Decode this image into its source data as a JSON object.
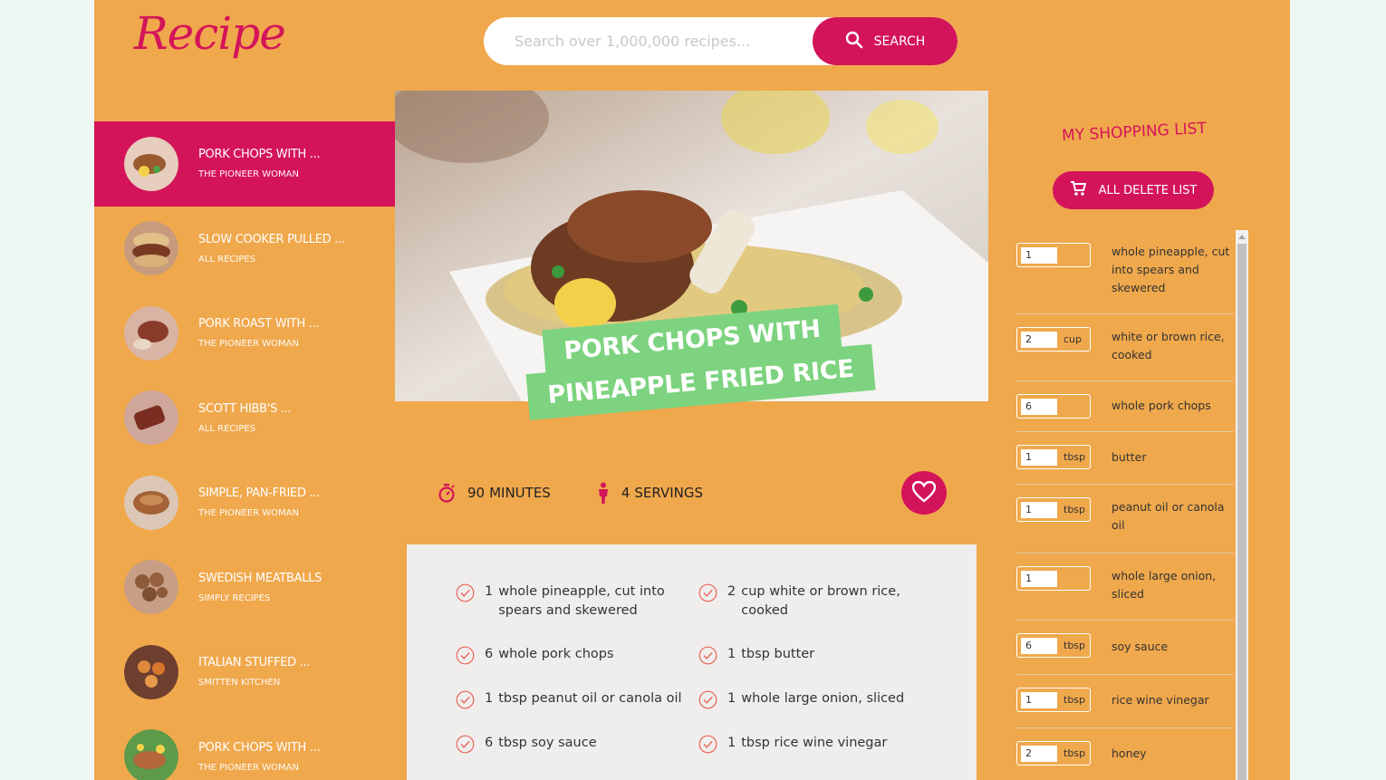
{
  "app": {
    "logo_text": "Recipe"
  },
  "search": {
    "placeholder": "Search over 1,000,000 recipes...",
    "button_label": "SEARCH",
    "icon": "search-icon"
  },
  "results": [
    {
      "title": "Pork Chops with ...",
      "publisher": "The Pioneer Woman",
      "active": true
    },
    {
      "title": "Slow Cooker Pulled ...",
      "publisher": "All Recipes",
      "active": false
    },
    {
      "title": "Pork Roast with ...",
      "publisher": "The Pioneer Woman",
      "active": false
    },
    {
      "title": "Scott Hibb's ...",
      "publisher": "All Recipes",
      "active": false
    },
    {
      "title": "Simple, Pan-Fried ...",
      "publisher": "The Pioneer Woman",
      "active": false
    },
    {
      "title": "Swedish Meatballs",
      "publisher": "Simply Recipes",
      "active": false
    },
    {
      "title": "Italian Stuffed ...",
      "publisher": "Smitten Kitchen",
      "active": false
    },
    {
      "title": "Pork Chops with ...",
      "publisher": "The Pioneer Woman",
      "active": false
    }
  ],
  "recipe": {
    "title_line1": "PORK CHOPS WITH",
    "title_line2": "PINEAPPLE FRIED RICE",
    "minutes_value": "90",
    "minutes_label": "MINUTES",
    "servings_value": "4",
    "servings_label": "SERVINGS",
    "ingredients": [
      {
        "count": "1",
        "text": "whole pineapple, cut into spears and skewered"
      },
      {
        "count": "2",
        "text": "cup white or brown rice, cooked"
      },
      {
        "count": "6",
        "text": "whole pork chops"
      },
      {
        "count": "1",
        "text": "tbsp butter"
      },
      {
        "count": "1",
        "text": "tbsp peanut oil or canola oil"
      },
      {
        "count": "1",
        "text": "whole large onion, sliced"
      },
      {
        "count": "6",
        "text": "tbsp soy sauce"
      },
      {
        "count": "1",
        "text": "tbsp rice wine vinegar"
      }
    ]
  },
  "shopping": {
    "title": "MY SHOPPING LIST",
    "delete_label": "ALL DELETE LIST",
    "items": [
      {
        "qty": "1",
        "unit": "",
        "desc": "whole pineapple, cut into spears and skewered"
      },
      {
        "qty": "2",
        "unit": "cup",
        "desc": "white or brown rice, cooked"
      },
      {
        "qty": "6",
        "unit": "",
        "desc": "whole pork chops"
      },
      {
        "qty": "1",
        "unit": "tbsp",
        "desc": "butter"
      },
      {
        "qty": "1",
        "unit": "tbsp",
        "desc": "peanut oil or canola oil"
      },
      {
        "qty": "1",
        "unit": "",
        "desc": "whole large onion, sliced"
      },
      {
        "qty": "6",
        "unit": "tbsp",
        "desc": "soy sauce"
      },
      {
        "qty": "1",
        "unit": "tbsp",
        "desc": "rice wine vinegar"
      },
      {
        "qty": "2",
        "unit": "tbsp",
        "desc": "honey"
      }
    ]
  },
  "colors": {
    "accent": "#d4145a",
    "background": "#f0a84c",
    "title_green": "#7dd37f",
    "panel": "#f0eeec"
  }
}
